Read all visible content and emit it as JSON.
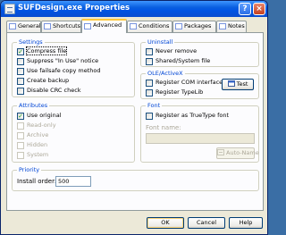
{
  "window": {
    "title": "SUFDesign.exe Properties",
    "help_glyph": "?",
    "close_glyph": "×"
  },
  "tabs": [
    {
      "label": "General"
    },
    {
      "label": "Shortcuts"
    },
    {
      "label": "Advanced"
    },
    {
      "label": "Conditions"
    },
    {
      "label": "Packages"
    },
    {
      "label": "Notes"
    }
  ],
  "settings": {
    "title": "Settings",
    "items": [
      {
        "label": "Compress file",
        "checked": true
      },
      {
        "label": "Suppress \"In Use\" notice",
        "checked": false
      },
      {
        "label": "Use failsafe copy method",
        "checked": false
      },
      {
        "label": "Create backup",
        "checked": false
      },
      {
        "label": "Disable CRC check",
        "checked": false
      }
    ]
  },
  "uninstall": {
    "title": "Uninstall",
    "items": [
      {
        "label": "Never remove",
        "checked": false
      },
      {
        "label": "Shared/System file",
        "checked": false
      }
    ]
  },
  "ole": {
    "title": "OLE/ActiveX",
    "items": [
      {
        "label": "Register COM interfaces",
        "checked": false
      },
      {
        "label": "Register TypeLib",
        "checked": false
      }
    ],
    "test_label": "Test"
  },
  "attributes": {
    "title": "Attributes",
    "items": [
      {
        "label": "Use original",
        "checked": true,
        "enabled": true
      },
      {
        "label": "Read-only",
        "checked": false,
        "enabled": false
      },
      {
        "label": "Archive",
        "checked": false,
        "enabled": false
      },
      {
        "label": "Hidden",
        "checked": false,
        "enabled": false
      },
      {
        "label": "System",
        "checked": false,
        "enabled": false
      }
    ]
  },
  "font": {
    "title": "Font",
    "register_label": "Register as TrueType font",
    "register_checked": false,
    "name_label": "Font name:",
    "name_value": "",
    "auto_name_label": "Auto-Name"
  },
  "priority": {
    "title": "Priority",
    "install_order_label": "Install order:",
    "install_order_value": "500"
  },
  "buttons": {
    "ok": "OK",
    "cancel": "Cancel",
    "help": "Help"
  }
}
